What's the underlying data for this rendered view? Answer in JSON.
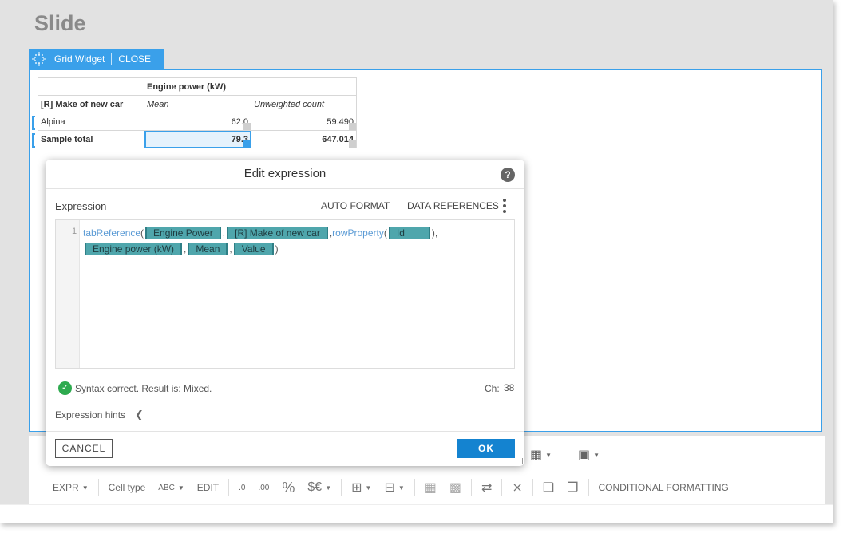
{
  "page": {
    "title": "Slide"
  },
  "widget": {
    "label": "Grid Widget",
    "close_label": "CLOSE"
  },
  "grid": {
    "header_top": "Engine power (kW)",
    "row_header_label": "[R] Make of new car",
    "col_mean": "Mean",
    "col_count": "Unweighted count",
    "rows": [
      {
        "label": "Alpina",
        "mean": "62.0",
        "count": "59.490",
        "bold": false
      },
      {
        "label": "Sample total",
        "mean": "79.3",
        "count": "647.014",
        "bold": true
      }
    ]
  },
  "dialog": {
    "title": "Edit expression",
    "help": "?",
    "expression_label": "Expression",
    "auto_format": "AUTO FORMAT",
    "data_references": "DATA REFERENCES",
    "line_number": "1",
    "code": {
      "fn1": "tabReference",
      "tok_engine_power": "Engine Power",
      "tok_make": "[R] Make of new car",
      "fn2": "rowProperty",
      "tok_id": "Id",
      "tok_engine_kw": "Engine power (kW)",
      "tok_mean": "Mean",
      "tok_value": "Value"
    },
    "status": "Syntax correct. Result is: Mixed.",
    "ch_label": "Ch:",
    "ch_value": "38",
    "hints_label": "Expression hints",
    "cancel_label": "CANCEL",
    "ok_label": "OK"
  },
  "toolbar": {
    "expr": "EXPR",
    "cell_type": "Cell type",
    "abc": "ABC",
    "edit": "EDIT",
    "dec_less": ".0",
    "dec_more": ".00",
    "percent": "%",
    "currency": "$€",
    "conditional": "CONDITIONAL FORMATTING"
  },
  "colors": {
    "accent": "#3aa0ea",
    "ok": "#1483d0",
    "token": "#4fa6ac",
    "success": "#2eaa4f"
  }
}
